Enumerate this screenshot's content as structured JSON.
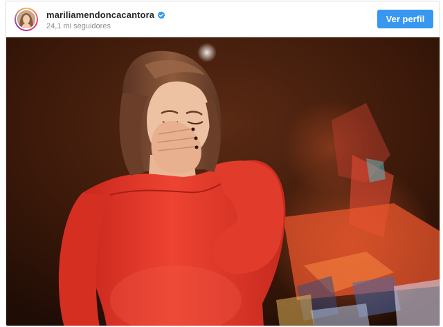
{
  "post": {
    "username": "mariliamendoncacantora",
    "followers": "24,1 mi seguidores",
    "view_profile_label": "Ver perfil",
    "verified": true,
    "accent_color": "#3897f0"
  },
  "photo": {
    "subject": "woman in red dress covering face on stage",
    "colors": {
      "dress": "#e8372a",
      "background": "#3a1a0c",
      "hair": "#7b4a32"
    }
  }
}
